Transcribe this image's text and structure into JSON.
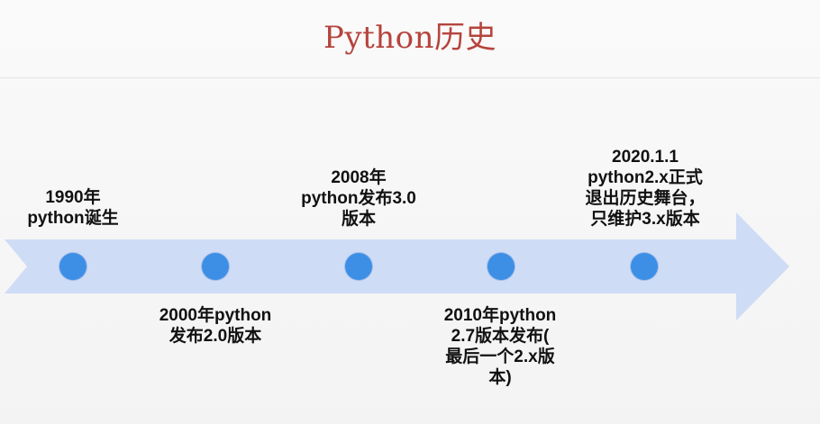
{
  "title": "Python历史",
  "colors": {
    "title": "#b5443d",
    "arrow": "#cfdcf6",
    "dot": "#3d8fe6",
    "text": "#111111"
  },
  "timeline": {
    "events": [
      {
        "text": "1990年\npython诞生"
      },
      {
        "text": "2000年python\n发布2.0版本"
      },
      {
        "text": "2008年\npython发布3.0\n版本"
      },
      {
        "text": "2010年python\n2.7版本发布(\n最后一个2.x版\n本)"
      },
      {
        "text": "2020.1.1\npython2.x正式\n退出历史舞台，\n只维护3.x版本"
      }
    ]
  }
}
